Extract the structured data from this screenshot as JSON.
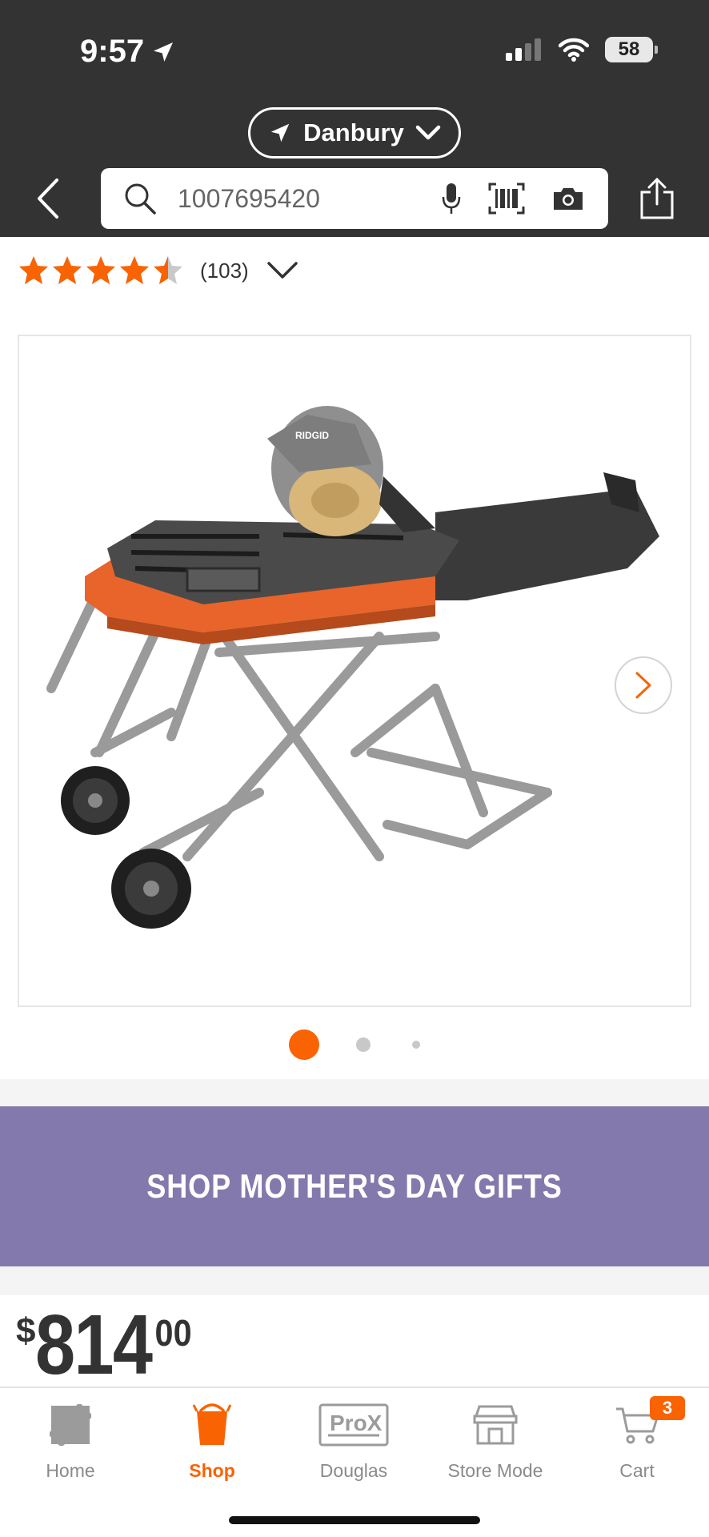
{
  "status_bar": {
    "time": "9:57",
    "battery": "58"
  },
  "header": {
    "location": "Danbury",
    "search_value": "1007695420"
  },
  "product": {
    "rating": 4.5,
    "review_count": "(103)",
    "image_alt": "RIDGID",
    "gallery_pages": 3,
    "gallery_active_index": 0
  },
  "promo": {
    "label": "SHOP MOTHER'S DAY GIFTS"
  },
  "price": {
    "currency": "$",
    "dollars": "814",
    "cents": "00"
  },
  "bottom_nav": {
    "items": [
      {
        "label": "Home",
        "icon": "home-depot-logo-icon"
      },
      {
        "label": "Shop",
        "icon": "shop-bucket-icon",
        "active": true
      },
      {
        "label": "Douglas",
        "icon": "prox-icon"
      },
      {
        "label": "Store Mode",
        "icon": "store-icon"
      },
      {
        "label": "Cart",
        "icon": "cart-icon",
        "badge": "3"
      }
    ],
    "prox_text": "ProX"
  },
  "colors": {
    "brand_orange": "#f96302",
    "header_bg": "#333333",
    "promo_bg": "#8479ac",
    "star": "#f96302"
  }
}
